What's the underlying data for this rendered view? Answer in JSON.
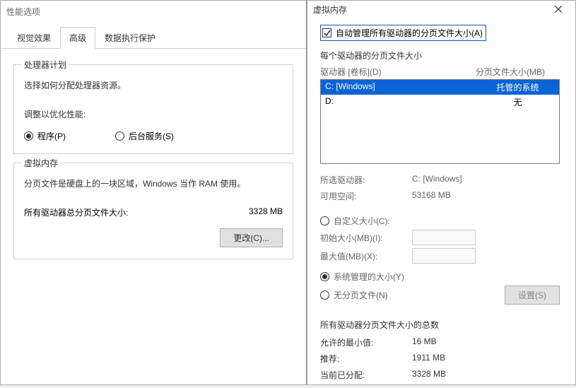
{
  "left": {
    "title": "性能选项",
    "tabs": {
      "visual": "视觉效果",
      "advanced": "高级",
      "dep": "数据执行保护"
    },
    "proc": {
      "group_title": "处理器计划",
      "desc": "选择如何分配处理器资源。",
      "optimize": "调整以优化性能:",
      "programs": "程序(P)",
      "services": "后台服务(S)"
    },
    "vm": {
      "group_title": "虚拟内存",
      "desc": "分页文件是硬盘上的一块区域，Windows 当作 RAM 使用。",
      "total_label": "所有驱动器总分页文件大小:",
      "total_value": "3328 MB",
      "change_btn": "更改(C)..."
    }
  },
  "right": {
    "title": "虚拟内存",
    "auto_manage": "自动管理所有驱动器的分页文件大小(A)",
    "each_drive_title": "每个驱动器的分页文件大小",
    "col_drive": "驱动器 [卷标](D)",
    "col_size": "分页文件大小(MB)",
    "drives": [
      {
        "label": "C:    [Windows]",
        "size": "托管的系统",
        "selected": true
      },
      {
        "label": "D:",
        "size": "无",
        "selected": false
      }
    ],
    "selected_drive_label": "所选驱动器:",
    "selected_drive_value": "C:  [Windows]",
    "free_space_label": "可用空间:",
    "free_space_value": "53168 MB",
    "custom_size": "自定义大小(C):",
    "initial_label": "初始大小(MB)(I):",
    "max_label": "最大值(MB)(X):",
    "system_managed": "系统管理的大小(Y)",
    "no_paging": "无分页文件(N)",
    "set_btn": "设置(S)",
    "totals_title": "所有驱动器分页文件大小的总数",
    "min_label": "允许的最小值:",
    "min_value": "16 MB",
    "rec_label": "推荐:",
    "rec_value": "1911 MB",
    "cur_label": "当前已分配:",
    "cur_value": "3328 MB"
  }
}
